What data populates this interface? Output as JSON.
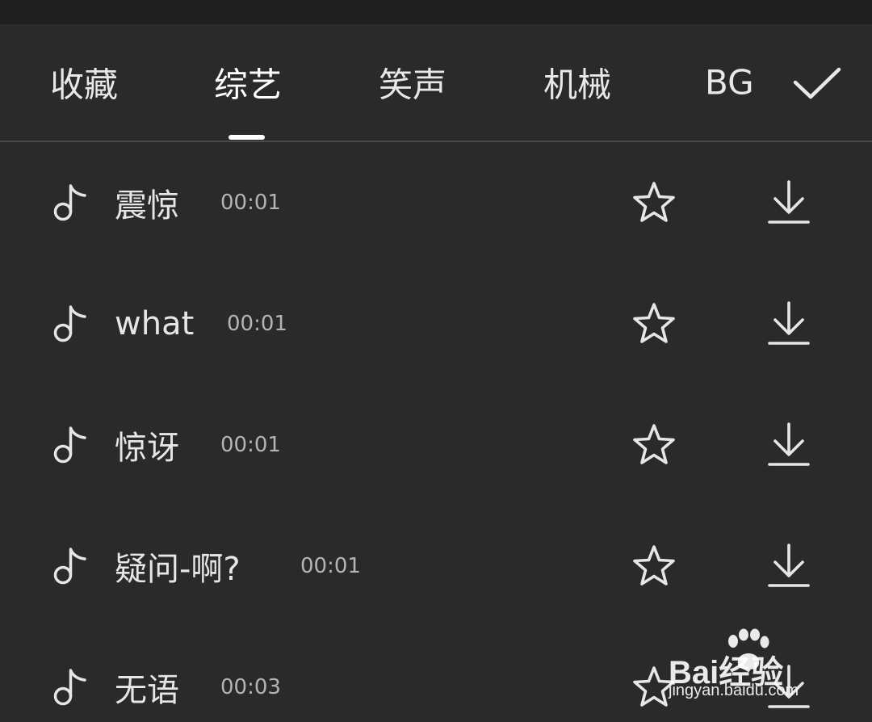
{
  "tabs": [
    {
      "label": "收藏"
    },
    {
      "label": "综艺"
    },
    {
      "label": "笑声"
    },
    {
      "label": "机械"
    },
    {
      "label": "BGM"
    }
  ],
  "active_tab": 1,
  "confirm_icon": "check-icon",
  "sounds": [
    {
      "title": "震惊",
      "duration": "00:01"
    },
    {
      "title": "what",
      "duration": "00:01"
    },
    {
      "title": "惊讶",
      "duration": "00:01"
    },
    {
      "title": "疑问-啊?",
      "duration": "00:01"
    },
    {
      "title": "无语",
      "duration": "00:03"
    }
  ],
  "row_icons": {
    "left": "music-note-icon",
    "favorite": "star-icon",
    "download": "download-icon"
  },
  "watermark": {
    "brand": "Bai经验",
    "url": "jingyan.baidu.com"
  },
  "colors": {
    "background": "#2a2a2a",
    "text": "#e6e6e6",
    "secondary_text": "#b4b4b4",
    "indicator": "#ffffff"
  }
}
